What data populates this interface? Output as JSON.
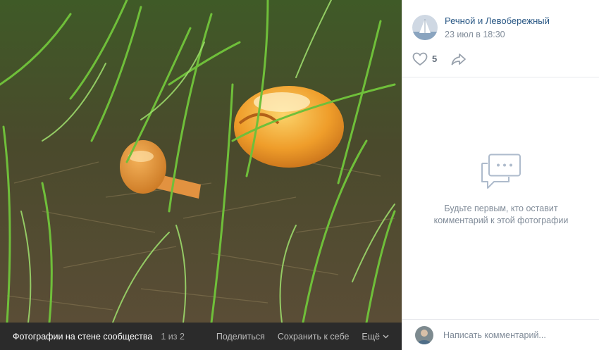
{
  "photo": {
    "description_icon": "mushroom-photo"
  },
  "photo_bar": {
    "album_label": "Фотографии на стене сообщества",
    "counter": "1 из 2",
    "share_label": "Поделиться",
    "save_label": "Сохранить к себе",
    "more_label": "Ещё"
  },
  "author": {
    "name": "Речной и Левобережный",
    "date": "23 июл в 18:30"
  },
  "actions": {
    "like_count": "5"
  },
  "comments": {
    "empty_text": "Будьте первым, кто оставит комментарий к этой фотографии",
    "placeholder": "Написать комментарий..."
  },
  "colors": {
    "link": "#2a5885",
    "muted": "#818c99",
    "icon": "#99a2ad",
    "bar_bg": "#2b2b2b"
  }
}
